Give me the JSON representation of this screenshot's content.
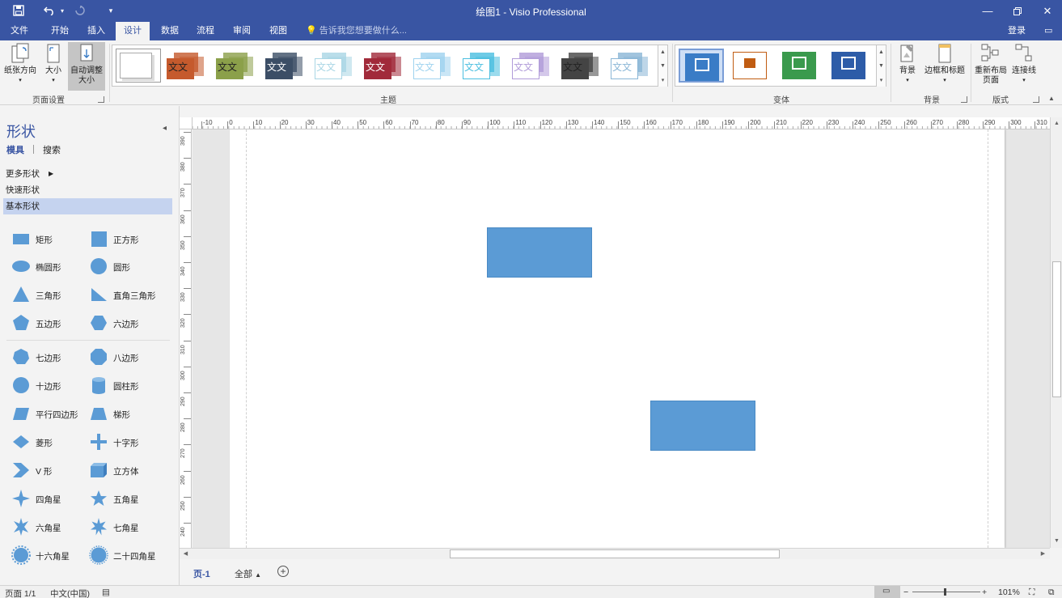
{
  "titlebar": {
    "title": "绘图1 - Visio Professional",
    "save_icon": "save-icon",
    "undo_icon": "undo-icon",
    "redo_icon": "redo-icon",
    "customize_icon": "customize-qat-icon"
  },
  "menu_tabs": [
    "文件",
    "开始",
    "插入",
    "设计",
    "数据",
    "流程",
    "审阅",
    "视图"
  ],
  "active_tab": "设计",
  "tell_me": "告诉我您想要做什么...",
  "login": "登录",
  "ribbon": {
    "page_setup": {
      "orientation": "纸张方向",
      "size": "大小",
      "auto_size_line1": "自动调整",
      "auto_size_line2": "大小",
      "label": "页面设置"
    },
    "themes": {
      "label": "主题",
      "sample_text": "文文",
      "colors": [
        "#ffffff",
        "#c55a2d",
        "#8ba04a",
        "#3c4e66",
        "#a9d6e5",
        "#a12a3a",
        "#9fd3ef",
        "#4bbfe0",
        "#b19cd9",
        "#444444",
        "#8ab6d6"
      ]
    },
    "variants": {
      "label": "变体",
      "colors": [
        "#3a7cc6",
        "#c05c12",
        "#3a9a4d",
        "#2d5ca8"
      ]
    },
    "backgrounds": {
      "background": "背景",
      "borders_titles": "边框和标题",
      "label": "背景"
    },
    "layout": {
      "relayout_line1": "重新布局",
      "relayout_line2": "页面",
      "connectors": "连接线",
      "label": "版式"
    }
  },
  "shapes_panel": {
    "title": "形状",
    "tab_stencils": "模具",
    "tab_search": "搜索",
    "more_shapes": "更多形状",
    "quick_shapes": "快速形状",
    "basic_shapes": "基本形状",
    "items": [
      {
        "label": "矩形",
        "icon": "rectangle-shape-icon"
      },
      {
        "label": "正方形",
        "icon": "square-shape-icon"
      },
      {
        "label": "椭圆形",
        "icon": "ellipse-shape-icon"
      },
      {
        "label": "圆形",
        "icon": "circle-shape-icon"
      },
      {
        "label": "三角形",
        "icon": "triangle-shape-icon"
      },
      {
        "label": "直角三角形",
        "icon": "right-triangle-shape-icon"
      },
      {
        "label": "五边形",
        "icon": "pentagon-shape-icon"
      },
      {
        "label": "六边形",
        "icon": "hexagon-shape-icon"
      },
      {
        "label": "七边形",
        "icon": "heptagon-shape-icon"
      },
      {
        "label": "八边形",
        "icon": "octagon-shape-icon"
      },
      {
        "label": "十边形",
        "icon": "decagon-shape-icon"
      },
      {
        "label": "圆柱形",
        "icon": "cylinder-shape-icon"
      },
      {
        "label": "平行四边形",
        "icon": "parallelogram-shape-icon"
      },
      {
        "label": "梯形",
        "icon": "trapezoid-shape-icon"
      },
      {
        "label": "菱形",
        "icon": "diamond-shape-icon"
      },
      {
        "label": "十字形",
        "icon": "cross-shape-icon"
      },
      {
        "label": "V 形",
        "icon": "chevron-shape-icon"
      },
      {
        "label": "立方体",
        "icon": "cube-shape-icon"
      },
      {
        "label": "四角星",
        "icon": "four-point-star-icon"
      },
      {
        "label": "五角星",
        "icon": "five-point-star-icon"
      },
      {
        "label": "六角星",
        "icon": "six-point-star-icon"
      },
      {
        "label": "七角星",
        "icon": "seven-point-star-icon"
      },
      {
        "label": "十六角星",
        "icon": "sixteen-point-star-icon"
      },
      {
        "label": "二十四角星",
        "icon": "twenty-four-point-star-icon"
      }
    ]
  },
  "rulers": {
    "horizontal": [
      "-10",
      "0",
      "10",
      "20",
      "30",
      "40",
      "50",
      "60",
      "70",
      "80",
      "90",
      "100",
      "110",
      "120",
      "130",
      "140",
      "150",
      "160",
      "170",
      "180",
      "190",
      "200",
      "210",
      "220",
      "230",
      "240",
      "250",
      "260",
      "270",
      "280",
      "290",
      "300",
      "310"
    ],
    "vertical": [
      "390",
      "380",
      "370",
      "360",
      "350",
      "340",
      "330",
      "320",
      "310",
      "300",
      "290",
      "280",
      "270",
      "260",
      "250",
      "240"
    ]
  },
  "canvas": {
    "shape_color": "#5b9bd5"
  },
  "page_tabs": {
    "current": "页-1",
    "all": "全部",
    "add_icon": "add-page-icon"
  },
  "statusbar": {
    "page": "页面 1/1",
    "language": "中文(中国)",
    "zoom": "101%"
  }
}
